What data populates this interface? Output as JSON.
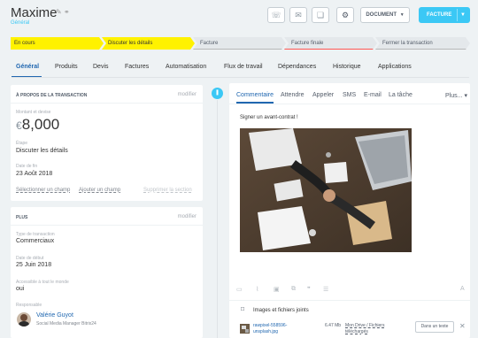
{
  "header": {
    "title": "Maxime",
    "subtitle": "Général",
    "icons": [
      "pencil-icon",
      "link-icon",
      "phone-icon",
      "mail-icon",
      "chat-icon",
      "gear-icon"
    ],
    "document_label": "DOCUMENT",
    "document_caret": "▼",
    "facture_label": "FACTURE",
    "facture_caret": "▼"
  },
  "pipeline": [
    {
      "label": "En cours",
      "state": "active"
    },
    {
      "label": "Discuter les détails",
      "state": "active"
    },
    {
      "label": "Facture",
      "state": "inactive"
    },
    {
      "label": "Facture finale",
      "state": "inactive"
    },
    {
      "label": "Fermer la transaction",
      "state": "inactive"
    }
  ],
  "tabs": [
    "Général",
    "Produits",
    "Devis",
    "Factures",
    "Automatisation",
    "Flux de travail",
    "Dépendances",
    "Historique",
    "Applications"
  ],
  "about": {
    "title": "À PROPOS DE LA TRANSACTION",
    "modify": "modifier",
    "amount_label": "Montant et devise",
    "amount_currency": "€",
    "amount_value": "8,000",
    "stage_label": "Étape",
    "stage_value": "Discuter les détails",
    "end_label": "Date de fin",
    "end_value": "23 Août 2018",
    "select_field": "Sélectionner un champ",
    "add_field": "Ajouter un champ",
    "delete_section": "Supprimer la section"
  },
  "plus": {
    "title": "PLUS",
    "modify": "modifier",
    "type_label": "Type de transaction",
    "type_value": "Commerciaux",
    "start_label": "Date de début",
    "start_value": "25 Juin 2018",
    "access_label": "Accessible à tout le monde",
    "access_value": "oui",
    "resp_label": "Responsable",
    "resp_name": "Valérie Guyot",
    "resp_role": "Social Media Manager Bitrix24"
  },
  "timeline": {
    "tabs": [
      "Commentaire",
      "Attendre",
      "Appeler",
      "SMS",
      "E-mail",
      "La tâche",
      "Plus..."
    ],
    "plus_caret": "▾",
    "message": "Signer un avant-contrat !",
    "toolbar_icons": [
      "video-icon",
      "paperclip-icon",
      "folder-icon",
      "copy-icon",
      "quote-icon",
      "layout-icon",
      "font-icon"
    ],
    "toolbar_glyphs": [
      "▭",
      "⌇",
      "▣",
      "⧉",
      "❞",
      "☰",
      "A"
    ],
    "attachments_title": "Images et fichiers joints",
    "file_name_1": "rawpixel-558596-",
    "file_name_2": "unsplash.jpg",
    "file_size": "6.47 Mb",
    "file_path_1": "Mon Drive / Fichiers",
    "file_path_2": "téléchargés",
    "in_text": "Dans un texte",
    "close": "✕"
  },
  "colors": {
    "accent": "#3bc8f5",
    "stage_active": "#fff200",
    "link": "#2067b0"
  }
}
